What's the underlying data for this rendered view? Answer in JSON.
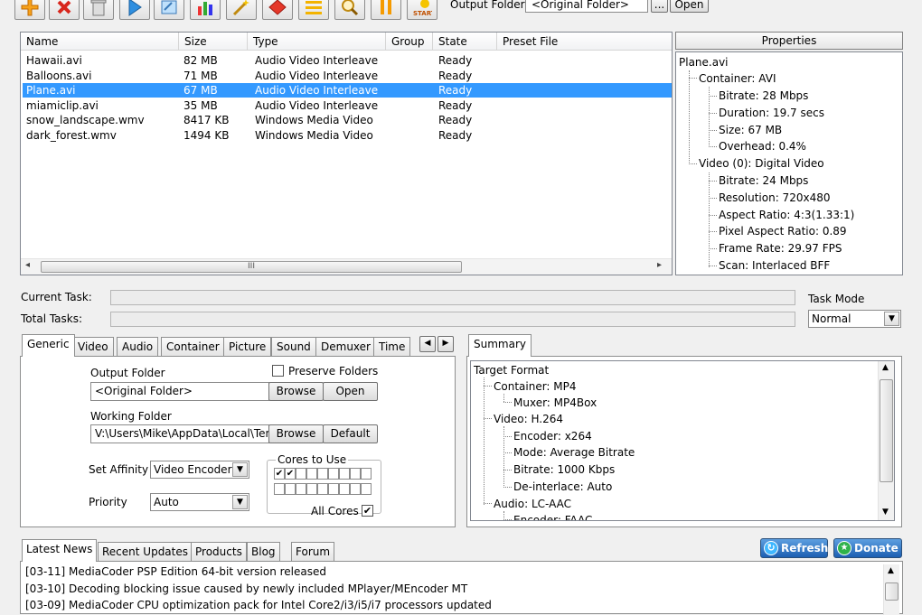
{
  "toolbar": {
    "buttons": [
      "add-icon",
      "remove-icon",
      "trash-icon",
      "play-icon",
      "open-icon",
      "chart-icon",
      "wand-icon",
      "tools-icon",
      "list-icon",
      "search-icon",
      "pause-icon",
      "start-icon"
    ],
    "start_label": "START",
    "output_folder_label": "Output Folder",
    "output_folder_value": "<Original Folder>",
    "browse_label": "...",
    "open_label": "Open"
  },
  "file_list": {
    "columns": [
      "Name",
      "Size",
      "Type",
      "Group",
      "State",
      "Preset File"
    ],
    "rows": [
      {
        "name": "Hawaii.avi",
        "size": "82 MB",
        "type": "Audio Video Interleave",
        "group": "",
        "state": "Ready",
        "preset": ""
      },
      {
        "name": "Balloons.avi",
        "size": "71 MB",
        "type": "Audio Video Interleave",
        "group": "",
        "state": "Ready",
        "preset": ""
      },
      {
        "name": "Plane.avi",
        "size": "67 MB",
        "type": "Audio Video Interleave",
        "group": "",
        "state": "Ready",
        "preset": ""
      },
      {
        "name": "miamiclip.avi",
        "size": "35 MB",
        "type": "Audio Video Interleave",
        "group": "",
        "state": "Ready",
        "preset": ""
      },
      {
        "name": "snow_landscape.wmv",
        "size": "8417 KB",
        "type": "Windows Media Video",
        "group": "",
        "state": "Ready",
        "preset": ""
      },
      {
        "name": "dark_forest.wmv",
        "size": "1494 KB",
        "type": "Windows Media Video",
        "group": "",
        "state": "Ready",
        "preset": ""
      }
    ],
    "selected_index": 2,
    "scroll_grip": "III"
  },
  "properties": {
    "header": "Properties",
    "root": "Plane.avi",
    "container": "Container: AVI",
    "container_items": [
      "Bitrate: 28 Mbps",
      "Duration: 19.7 secs",
      "Size: 67 MB",
      "Overhead: 0.4%"
    ],
    "video": "Video (0): Digital Video",
    "video_items": [
      "Bitrate: 24 Mbps",
      "Resolution: 720x480",
      "Aspect Ratio: 4:3(1.33:1)",
      "Pixel Aspect Ratio: 0.89",
      "Frame Rate: 29.97 FPS",
      "Scan: Interlaced BFF"
    ]
  },
  "progress": {
    "current_task_label": "Current Task:",
    "total_tasks_label": "Total Tasks:",
    "task_mode_label": "Task Mode",
    "task_mode_value": "Normal"
  },
  "settings_tabs": [
    "Generic",
    "Video",
    "Audio",
    "Container",
    "Picture",
    "Sound",
    "Demuxer",
    "Time"
  ],
  "generic": {
    "output_folder_label": "Output Folder",
    "output_folder_value": "<Original Folder>",
    "browse": "Browse",
    "open": "Open",
    "preserve_folders": "Preserve Folders",
    "working_folder_label": "Working Folder",
    "working_folder_value": "V:\\Users\\Mike\\AppData\\Local\\Tem",
    "browse2": "Browse",
    "default": "Default",
    "affinity_label": "Set Affinity",
    "affinity_value": "Video Encoder",
    "priority_label": "Priority",
    "priority_value": "Auto",
    "cores_label": "Cores to Use",
    "cores_row1": [
      true,
      true,
      false,
      false,
      false,
      false,
      false,
      false,
      false
    ],
    "cores_row2": [
      false,
      false,
      false,
      false,
      false,
      false,
      false,
      false,
      false
    ],
    "all_cores": "All Cores"
  },
  "summary": {
    "tab": "Summary",
    "root": "Target Format",
    "container": "Container: MP4",
    "muxer": "Muxer: MP4Box",
    "video": "Video: H.264",
    "video_items": [
      "Encoder: x264",
      "Mode: Average Bitrate",
      "Bitrate: 1000 Kbps",
      "De-interlace: Auto"
    ],
    "audio": "Audio: LC-AAC",
    "audio_items": [
      "Encoder: FAAC"
    ]
  },
  "news": {
    "tabs": [
      "Latest News",
      "Recent Updates",
      "Products",
      "Blog",
      "Forum"
    ],
    "refresh": "Refresh",
    "donate": "Donate",
    "items": [
      "[03-11] MediaCoder PSP Edition 64-bit version released",
      "[03-10] Decoding blocking issue caused by newly included MPlayer/MEncoder MT",
      "[03-09] MediaCoder CPU optimization pack for Intel Core2/i3/i5/i7 processors updated"
    ]
  }
}
